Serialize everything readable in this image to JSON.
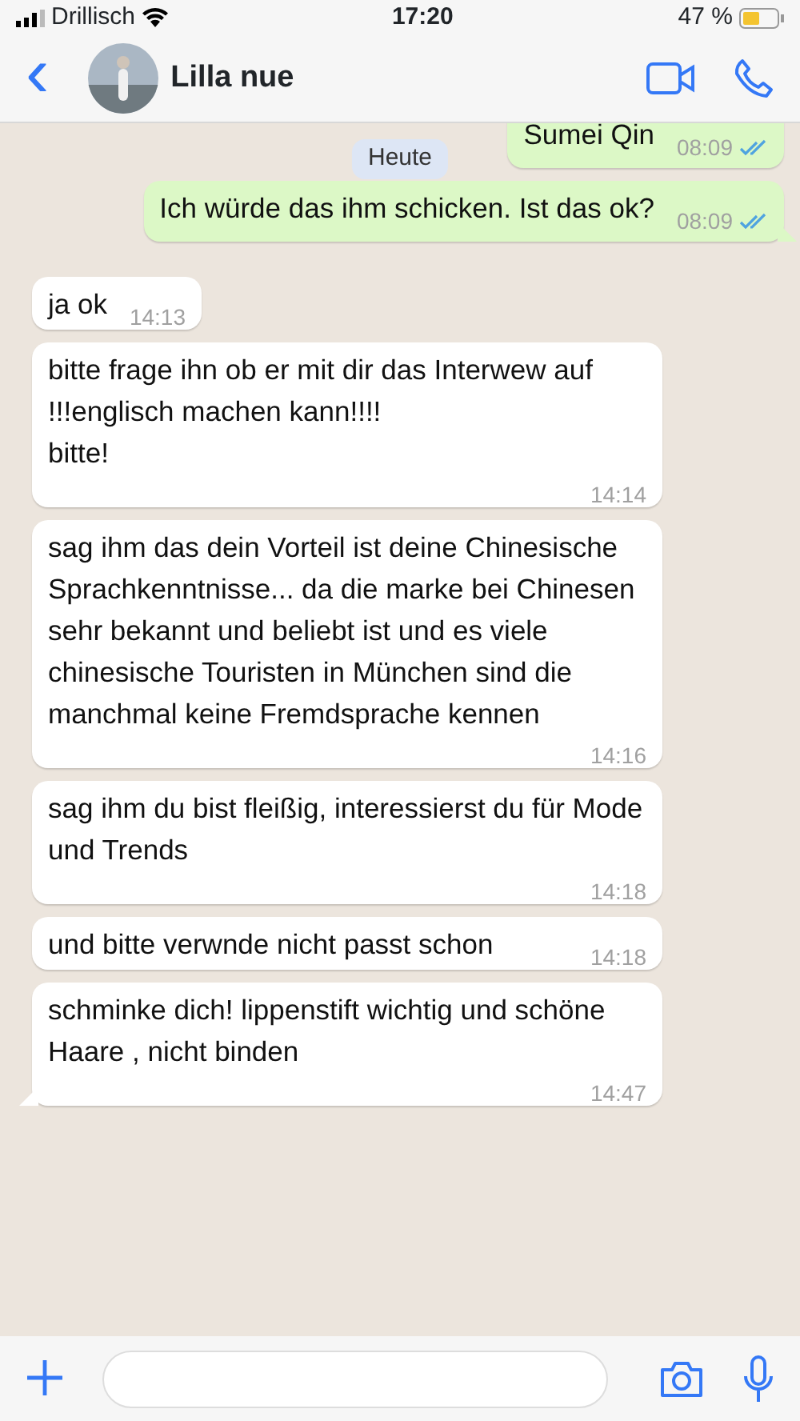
{
  "status_bar": {
    "carrier": "Drillisch",
    "time": "17:20",
    "battery": "47 %"
  },
  "header": {
    "back": "‹",
    "name": "Lilla nue"
  },
  "date_badge": "Heute",
  "messages": [
    {
      "kind": "outgoing",
      "text": "Sumei Qin",
      "time": "08:09",
      "read": true,
      "tail": false
    },
    {
      "kind": "outgoing",
      "text": "Ich würde das ihm schicken. Ist das ok?",
      "time": "08:09",
      "read": true,
      "tail": true
    },
    {
      "kind": "incoming",
      "text": "ja ok",
      "time": "14:13",
      "tail": false
    },
    {
      "kind": "incoming",
      "text": "bitte frage ihn ob er mit dir das Interwew auf !!!englisch machen kann!!!!\nbitte!",
      "time": "14:14",
      "tail": false
    },
    {
      "kind": "incoming",
      "text": "sag ihm das dein Vorteil ist deine Chinesische Sprachkenntnisse... da die marke bei Chinesen sehr bekannt und beliebt ist und es viele  chinesische Touristen in München sind die manchmal keine Fremdsprache kennen",
      "time": "14:16",
      "tail": false
    },
    {
      "kind": "incoming",
      "text": "sag ihm du bist fleißig, interessierst du für Mode und Trends",
      "time": "14:18",
      "tail": false
    },
    {
      "kind": "incoming",
      "text": "und bitte verwnde nicht passt schon",
      "time": "14:18",
      "tail": false
    },
    {
      "kind": "incoming",
      "text": "schminke dich! lippenstift wichtig und schöne Haare , nicht binden",
      "time": "14:47",
      "tail": true
    }
  ]
}
